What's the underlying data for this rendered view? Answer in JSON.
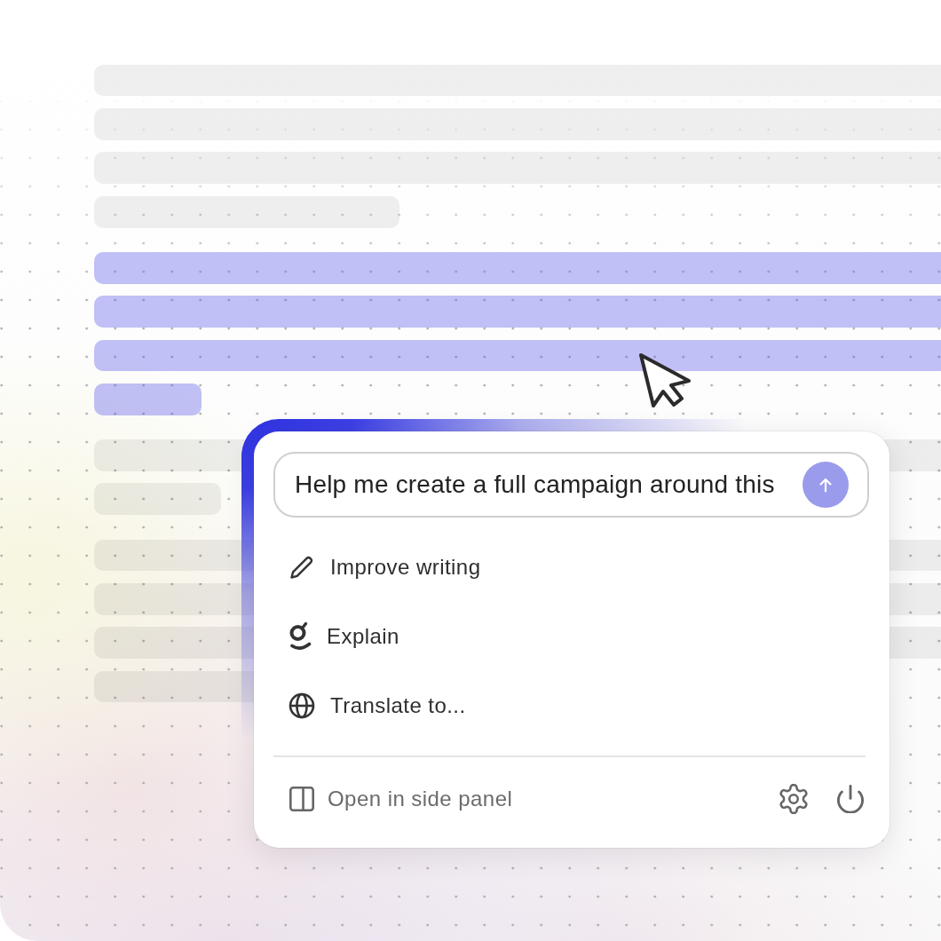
{
  "document": {
    "paragraphs": [
      {
        "selected": false,
        "lines": [
          {
            "kind": "full"
          },
          {
            "kind": "full"
          },
          {
            "kind": "full"
          },
          {
            "kind": "short"
          }
        ]
      },
      {
        "selected": true,
        "lines": [
          {
            "kind": "full"
          },
          {
            "kind": "full"
          },
          {
            "kind": "full"
          },
          {
            "kind": "short"
          }
        ]
      },
      {
        "selected": false,
        "lines": [
          {
            "kind": "full"
          },
          {
            "kind": "short"
          }
        ]
      },
      {
        "selected": false,
        "lines": [
          {
            "kind": "full"
          },
          {
            "kind": "full"
          },
          {
            "kind": "full"
          },
          {
            "kind": "short"
          }
        ]
      }
    ]
  },
  "popup": {
    "prompt": {
      "value": "Help me create a full campaign around this"
    },
    "actions": [
      {
        "label": "Improve writing"
      },
      {
        "label": "Explain"
      },
      {
        "label": "Translate to..."
      }
    ],
    "footer": {
      "side_panel_link": "Open in side panel"
    }
  }
}
